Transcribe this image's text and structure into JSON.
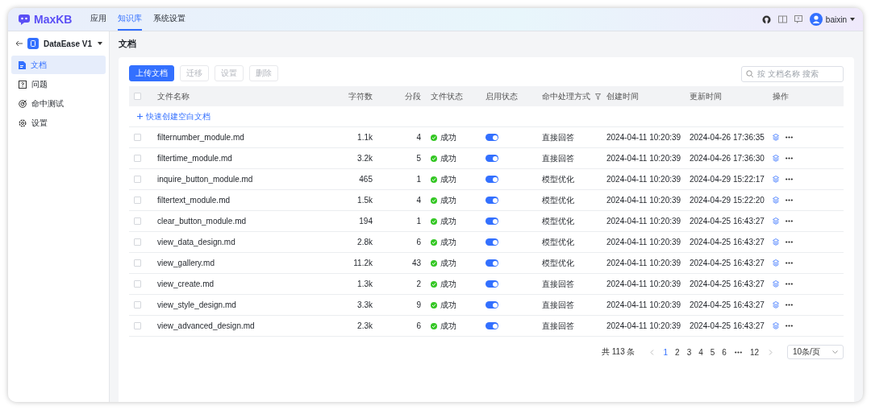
{
  "header": {
    "logo": "MaxKB",
    "nav": [
      {
        "label": "应用",
        "selected": false
      },
      {
        "label": "知识库",
        "selected": true
      },
      {
        "label": "系统设置",
        "selected": false
      }
    ],
    "user": "baixin"
  },
  "sidebar": {
    "dataset": "DataEase V1",
    "items": [
      {
        "label": "文档",
        "kind": "document",
        "selected": true
      },
      {
        "label": "问题",
        "kind": "question",
        "selected": false
      },
      {
        "label": "命中测试",
        "kind": "target",
        "selected": false
      },
      {
        "label": "设置",
        "kind": "gear",
        "selected": false
      }
    ]
  },
  "page_title": "文档",
  "toolbar": [
    {
      "label": "上传文档",
      "disabled": false
    },
    {
      "label": "迁移",
      "disabled": true
    },
    {
      "label": "设置",
      "disabled": true
    },
    {
      "label": "删除",
      "disabled": true
    }
  ],
  "search": {
    "placeholder": "按 文档名称 搜索"
  },
  "table": {
    "columns": [
      {
        "label": "文件名称",
        "filter": false
      },
      {
        "label": "字符数",
        "filter": false
      },
      {
        "label": "分段",
        "filter": false
      },
      {
        "label": "文件状态",
        "filter": false
      },
      {
        "label": "启用状态",
        "filter": false
      },
      {
        "label": "命中处理方式",
        "filter": true
      },
      {
        "label": "创建时间",
        "filter": false
      },
      {
        "label": "更新时间",
        "filter": false
      },
      {
        "label": "操作",
        "filter": false
      }
    ],
    "all_checked": false,
    "create_link": "快速创建空白文档",
    "rows": [
      {
        "checked": false,
        "name": "filternumber_module.md",
        "chars": "1.1k",
        "segments": "4",
        "status": "成功",
        "enabled": true,
        "hit_mode": "直接回答",
        "created": "2024-04-11 10:20:39",
        "updated": "2024-04-26 17:36:35"
      },
      {
        "checked": false,
        "name": "filtertime_module.md",
        "chars": "3.2k",
        "segments": "5",
        "status": "成功",
        "enabled": true,
        "hit_mode": "直接回答",
        "created": "2024-04-11 10:20:39",
        "updated": "2024-04-26 17:36:30"
      },
      {
        "checked": false,
        "name": "inquire_button_module.md",
        "chars": "465",
        "segments": "1",
        "status": "成功",
        "enabled": true,
        "hit_mode": "模型优化",
        "created": "2024-04-11 10:20:39",
        "updated": "2024-04-29 15:22:17"
      },
      {
        "checked": false,
        "name": "filtertext_module.md",
        "chars": "1.5k",
        "segments": "4",
        "status": "成功",
        "enabled": true,
        "hit_mode": "模型优化",
        "created": "2024-04-11 10:20:39",
        "updated": "2024-04-29 15:22:20"
      },
      {
        "checked": false,
        "name": "clear_button_module.md",
        "chars": "194",
        "segments": "1",
        "status": "成功",
        "enabled": true,
        "hit_mode": "模型优化",
        "created": "2024-04-11 10:20:39",
        "updated": "2024-04-25 16:43:27"
      },
      {
        "checked": false,
        "name": "view_data_design.md",
        "chars": "2.8k",
        "segments": "6",
        "status": "成功",
        "enabled": true,
        "hit_mode": "模型优化",
        "created": "2024-04-11 10:20:39",
        "updated": "2024-04-25 16:43:27"
      },
      {
        "checked": false,
        "name": "view_gallery.md",
        "chars": "11.2k",
        "segments": "43",
        "status": "成功",
        "enabled": true,
        "hit_mode": "模型优化",
        "created": "2024-04-11 10:20:39",
        "updated": "2024-04-25 16:43:27"
      },
      {
        "checked": false,
        "name": "view_create.md",
        "chars": "1.3k",
        "segments": "2",
        "status": "成功",
        "enabled": true,
        "hit_mode": "直接回答",
        "created": "2024-04-11 10:20:39",
        "updated": "2024-04-25 16:43:27"
      },
      {
        "checked": false,
        "name": "view_style_design.md",
        "chars": "3.3k",
        "segments": "9",
        "status": "成功",
        "enabled": true,
        "hit_mode": "直接回答",
        "created": "2024-04-11 10:20:39",
        "updated": "2024-04-25 16:43:27"
      },
      {
        "checked": false,
        "name": "view_advanced_design.md",
        "chars": "2.3k",
        "segments": "6",
        "status": "成功",
        "enabled": true,
        "hit_mode": "直接回答",
        "created": "2024-04-11 10:20:39",
        "updated": "2024-04-25 16:43:27"
      }
    ]
  },
  "pagination": {
    "total": "共 113 条",
    "pages": [
      {
        "kind": "page",
        "label": "1",
        "selected": true
      },
      {
        "kind": "page",
        "label": "2",
        "selected": false
      },
      {
        "kind": "page",
        "label": "3",
        "selected": false
      },
      {
        "kind": "page",
        "label": "4",
        "selected": false
      },
      {
        "kind": "page",
        "label": "5",
        "selected": false
      },
      {
        "kind": "page",
        "label": "6",
        "selected": false
      },
      {
        "kind": "more",
        "selected": false
      },
      {
        "kind": "page",
        "label": "12",
        "selected": false
      }
    ],
    "page_size": "10条/页"
  }
}
